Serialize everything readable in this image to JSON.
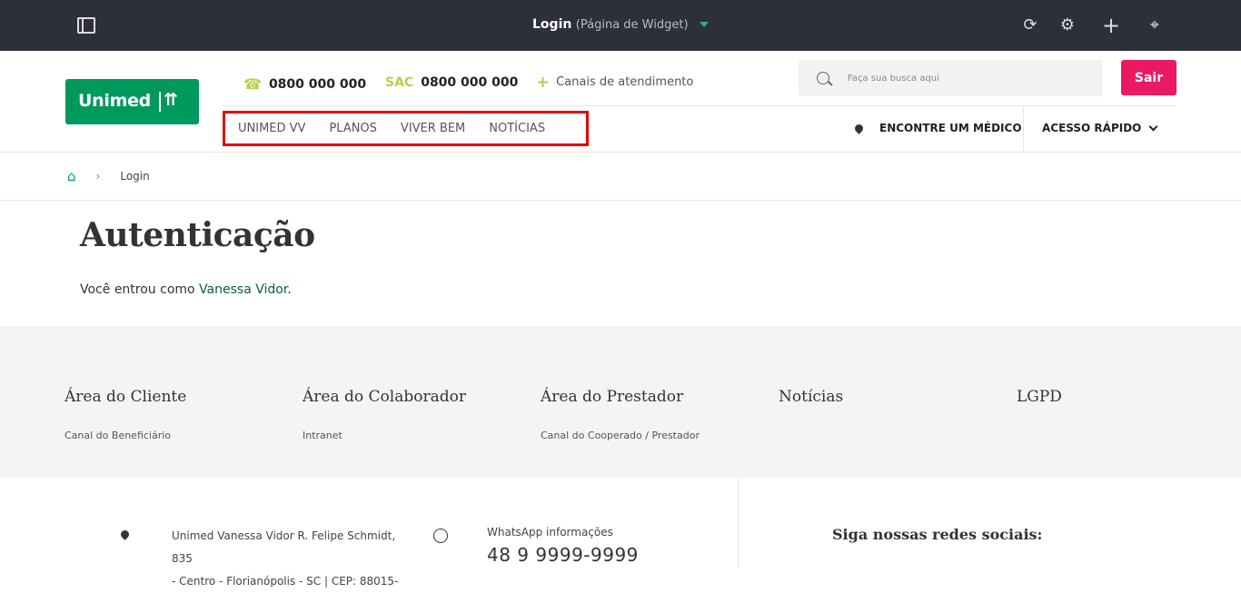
{
  "topbar": {
    "title": "Login",
    "subtitle": "(Página de Widget)"
  },
  "header": {
    "logo_text": "Unimed",
    "phone1": "0800 000 000",
    "sac_label": "SAC",
    "phone2": "0800 000 000",
    "channels": "Canais de atendimento",
    "search_placeholder": "Faça sua busca aqui",
    "logout_label": "Sair",
    "nav": [
      "UNIMED VV",
      "PLANOS",
      "VIVER BEM",
      "NOTÍCIAS"
    ],
    "find_doctor": "ENCONTRE UM MÉDICO",
    "quick_access": "ACESSO RÁPIDO"
  },
  "breadcrumb": {
    "sep": "›",
    "current": "Login"
  },
  "main": {
    "title": "Autenticação",
    "logged_prefix": "Você entrou como ",
    "user_name": "Vanessa Vidor",
    "logged_suffix": "."
  },
  "footer": {
    "columns": [
      {
        "heading": "Área do Cliente",
        "link": "Canal do Beneficiário"
      },
      {
        "heading": "Área do Colaborador",
        "link": "Intranet"
      },
      {
        "heading": "Área do Prestador",
        "link": "Canal do Cooperado / Prestador"
      },
      {
        "heading": "Notícias",
        "link": ""
      },
      {
        "heading": "LGPD",
        "link": ""
      }
    ],
    "address_line1": "Unimed Vanessa Vidor R. Felipe Schmidt, 835",
    "address_line2": "- Centro - Florianópolis - SC | CEP: 88015-",
    "whatsapp_label": "WhatsApp informações",
    "whatsapp_number": "48 9 9999-9999",
    "social_heading": "Siga nossas redes sociais:"
  }
}
